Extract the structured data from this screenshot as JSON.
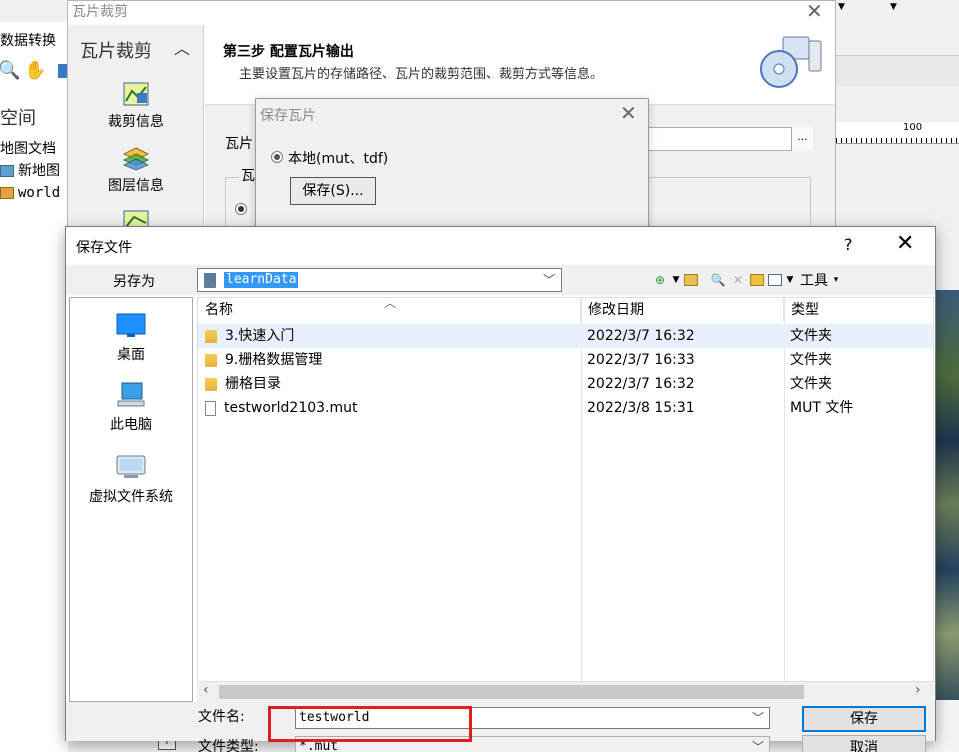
{
  "background_app": {
    "toolbar_label_convert": "数据转换",
    "workspace_title": "空间",
    "tree": [
      {
        "label": "地图文档",
        "icon": "map-document-icon"
      },
      {
        "label": "新地图",
        "icon": "new-map-icon"
      },
      {
        "label": "world",
        "icon": "layer-icon"
      }
    ],
    "ruler_label": "100",
    "status_icon": "↑"
  },
  "tile_dialog": {
    "title": "瓦片裁剪",
    "sidebar_title": "瓦片裁剪",
    "nav": [
      {
        "label": "裁剪信息",
        "icon": "clip-info-icon"
      },
      {
        "label": "图层信息",
        "icon": "layer-info-icon"
      }
    ],
    "step_title": "第三步 配置瓦片输出",
    "step_desc": "主要设置瓦片的存储路径、瓦片的裁剪范围、裁剪方式等信息。",
    "path_label": "瓦片",
    "browse_label": "...",
    "group_label": "瓦"
  },
  "save_tile_dialog": {
    "title": "保存瓦片",
    "radio_label": "本地(mut、tdf)",
    "save_button": "保存(S)..."
  },
  "save_file_dialog": {
    "title": "保存文件",
    "help": "?",
    "saveas_label": "另存为",
    "location": "learnData",
    "toolbar_tools": "工具",
    "places": [
      {
        "label": "桌面",
        "icon": "desktop-icon"
      },
      {
        "label": "此电脑",
        "icon": "computer-icon"
      },
      {
        "label": "虚拟文件系统",
        "icon": "virtual-fs-icon"
      }
    ],
    "columns": {
      "name": "名称",
      "date": "修改日期",
      "type": "类型"
    },
    "files": [
      {
        "name": "3.快速入门",
        "date": "2022/3/7 16:32",
        "type": "文件夹",
        "kind": "folder"
      },
      {
        "name": "9.栅格数据管理",
        "date": "2022/3/7 16:33",
        "type": "文件夹",
        "kind": "folder"
      },
      {
        "name": "栅格目录",
        "date": "2022/3/7 16:32",
        "type": "文件夹",
        "kind": "folder"
      },
      {
        "name": "testworld2103.mut",
        "date": "2022/3/8 15:31",
        "type": "MUT 文件",
        "kind": "file"
      }
    ],
    "filename_label": "文件名:",
    "filename_value": "testworld",
    "filetype_label": "文件类型:",
    "filetype_value": "*.mut",
    "save_button": "保存",
    "cancel_button": "取消"
  },
  "colors": {
    "accent": "#0078d7",
    "selection": "#3399ff",
    "highlight": "#e02020"
  }
}
